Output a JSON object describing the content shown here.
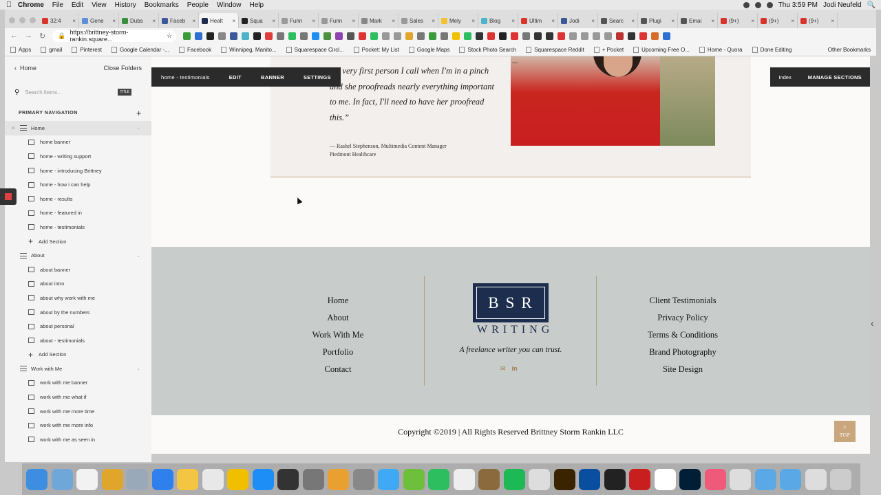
{
  "menubar": {
    "items": [
      "Chrome",
      "File",
      "Edit",
      "View",
      "History",
      "Bookmarks",
      "People",
      "Window",
      "Help"
    ],
    "clock": "Thu 3:59 PM",
    "user": "Jodi Neufeld"
  },
  "tabs": [
    {
      "label": "32:4",
      "color": "#d9342b"
    },
    {
      "label": "Gene",
      "color": "#5b8fd6"
    },
    {
      "label": "Dubs",
      "color": "#3a8f3e"
    },
    {
      "label": "Faceb",
      "color": "#3b5998"
    },
    {
      "label": "Healt",
      "color": "#1c2d4e",
      "active": true
    },
    {
      "label": "Squa",
      "color": "#222222"
    },
    {
      "label": "Funn",
      "color": "#999999"
    },
    {
      "label": "Funn",
      "color": "#999999"
    },
    {
      "label": "Mark",
      "color": "#888888"
    },
    {
      "label": "Sales",
      "color": "#999999"
    },
    {
      "label": "Mely",
      "color": "#f2c230"
    },
    {
      "label": "Blog",
      "color": "#4cb3c9"
    },
    {
      "label": "Ultim",
      "color": "#d9342b"
    },
    {
      "label": "Jodi",
      "color": "#3b5998"
    },
    {
      "label": "Searc",
      "color": "#555555"
    },
    {
      "label": "Plugi",
      "color": "#555555"
    },
    {
      "label": "Emai",
      "color": "#555555"
    },
    {
      "label": "(9+)",
      "color": "#d9342b"
    },
    {
      "label": "(9+)",
      "color": "#d9342b"
    },
    {
      "label": "(9+)",
      "color": "#d9342b"
    }
  ],
  "address": {
    "url": "https://brittney-storm-rankin.square..."
  },
  "bookmarks": [
    "Apps",
    "gmail",
    "Pinterest",
    "Google Calendar -...",
    "Facebook",
    "Winnipeg, Manito...",
    "Squarespace Circl...",
    "Pocket: My List",
    "Google Maps",
    "Stock Photo Search",
    "Squarespace Reddit",
    "+ Pocket",
    "Upcoming Free O...",
    "Home - Quora",
    "Done Editing"
  ],
  "bookmarks_other": "Other Bookmarks",
  "panel": {
    "back_label": "Home",
    "close_folders": "Close Folders",
    "search_placeholder": "Search items...",
    "search_tag": "TITLE",
    "primary_nav": "PRIMARY NAVIGATION",
    "rows": [
      {
        "type": "page",
        "label": "Home",
        "selected": true
      },
      {
        "type": "sec",
        "label": "home banner"
      },
      {
        "type": "sec",
        "label": "home - writing support"
      },
      {
        "type": "sec",
        "label": "home - introducing Brittney"
      },
      {
        "type": "sec",
        "label": "home - how i can help"
      },
      {
        "type": "sec",
        "label": "home - results"
      },
      {
        "type": "sec",
        "label": "home - featured in"
      },
      {
        "type": "sec",
        "label": "home - testimonials"
      },
      {
        "type": "add",
        "label": "Add Section"
      },
      {
        "type": "page",
        "label": "About"
      },
      {
        "type": "sec",
        "label": "about banner"
      },
      {
        "type": "sec",
        "label": "about intro"
      },
      {
        "type": "sec",
        "label": "about why work with me"
      },
      {
        "type": "sec",
        "label": "about by the numbers"
      },
      {
        "type": "sec",
        "label": "about personal"
      },
      {
        "type": "sec",
        "label": "about - testimonials"
      },
      {
        "type": "add",
        "label": "Add Section"
      },
      {
        "type": "page",
        "label": "Work with Me"
      },
      {
        "type": "sec",
        "label": "work with me banner"
      },
      {
        "type": "sec",
        "label": "work with me what if"
      },
      {
        "type": "sec",
        "label": "work with me more time"
      },
      {
        "type": "sec",
        "label": "work with me more info"
      },
      {
        "type": "sec",
        "label": "work with me as seen in"
      }
    ]
  },
  "section_toolbar": {
    "name": "home - testimonials",
    "edit": "EDIT",
    "banner": "BANNER",
    "settings": "SETTINGS",
    "index": "Index",
    "manage": "MANAGE SECTIONS"
  },
  "testimonial": {
    "quote": "the very first person I call when I'm in a pinch and she proofreads nearly everything important to me. In fact, I'll need to have her proofread this.”",
    "attribution_line1": "— Rashel Stephenson, Multimedia Content Manager",
    "attribution_line2": "Piedmont Healthcare"
  },
  "footer": {
    "left_links": [
      "Home",
      "About",
      "Work With Me",
      "Portfolio",
      "Contact"
    ],
    "right_links": [
      "Client Testimonials",
      "Privacy Policy",
      "Terms & Conditions",
      "Brand Photography",
      "Site Design"
    ],
    "logo_letters": "BSR",
    "logo_word": "WRITING",
    "tagline": "A freelance writer you can trust.",
    "social": [
      "email-icon",
      "linkedin-icon"
    ],
    "copyright": "Copyright ©2019 | All Rights Reserved Brittney Storm Rankin LLC",
    "top_label": "TOP",
    "accent": "#c9a67c",
    "navy": "#1c2d4e"
  },
  "dock_colors": [
    "#3d8ee0",
    "#6fa7d8",
    "#f2f2f2",
    "#e0a52b",
    "#9aa9b9",
    "#2f80ed",
    "#f4c542",
    "#e8e8e8",
    "#f0c000",
    "#1c8ef5",
    "#333333",
    "#777777",
    "#e9a030",
    "#888888",
    "#3fa9f5",
    "#6dbf3c",
    "#2dbe60",
    "#eeeeee",
    "#8b6b3d",
    "#1db954",
    "#dddddd",
    "#3a2400",
    "#0a4ea0",
    "#222222",
    "#c81e1e",
    "#ffffff",
    "#001e36",
    "#f05a7a",
    "#dddddd",
    "#5aa9e6",
    "#5aa9e6",
    "#dddddd",
    "#cccccc"
  ]
}
